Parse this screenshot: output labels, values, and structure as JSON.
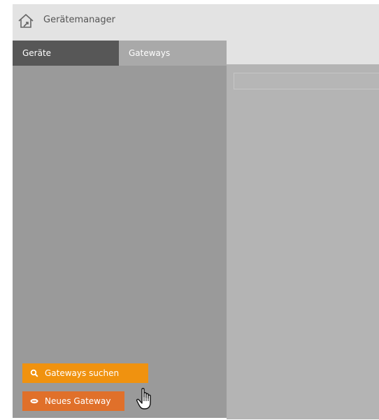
{
  "header": {
    "title": "Gerätemanager",
    "icon": "house-icon"
  },
  "tabs": [
    {
      "label": "Geräte",
      "active": false
    },
    {
      "label": "Gateways",
      "active": true
    }
  ],
  "actions": {
    "search_gateways": {
      "label": "Gateways suchen",
      "icon": "search-icon",
      "color": "#f0920f"
    },
    "new_gateway": {
      "label": "Neues Gateway",
      "icon": "gateway-icon",
      "color": "#e0702a"
    }
  },
  "details": {
    "search_value": ""
  },
  "colors": {
    "header_bg": "#e3e3e3",
    "tab_inactive_bg": "#575757",
    "panel_bg": "#9a9a9a",
    "detail_bg": "#b4b4b4"
  }
}
